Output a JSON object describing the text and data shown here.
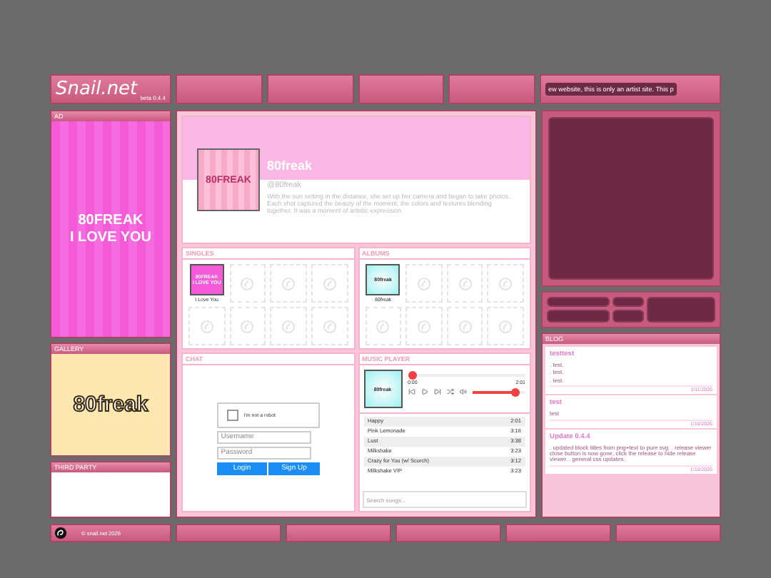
{
  "header": {
    "logo": "Snail.net",
    "version": "beta 0.4.4",
    "marquee": "ew website, this is only an artist site. This p"
  },
  "ad": {
    "title": "AD",
    "banner_lines": [
      "80FREAK",
      "I LOVE YOU"
    ]
  },
  "gallery": {
    "title": "GALLERY",
    "banner": "80freak"
  },
  "third_party": {
    "title": "THIRD PARTY"
  },
  "profile": {
    "cover": "80FREAK",
    "name": "80freak",
    "handle": "@80freak",
    "bio": "With the sun setting in the distance, she set up her camera and began to take photos. Each shot captured the beauty of the moment, the colors and textures blending together. It was a moment of artistic expression."
  },
  "singles": {
    "title": "SINGLES",
    "items": [
      {
        "cover_lines": [
          "80FREAK",
          "I LOVE YOU"
        ],
        "label": "I Love You"
      }
    ]
  },
  "albums": {
    "title": "ALBUMS",
    "items": [
      {
        "cover": "80freak",
        "label": "80freak"
      }
    ]
  },
  "chat": {
    "title": "CHAT",
    "captcha": "I'm not a robot",
    "captcha_checked": false,
    "username_placeholder": "Username",
    "password_placeholder": "Password",
    "buttons": [
      "Login",
      "Sign Up"
    ]
  },
  "player": {
    "title": "MUSIC PLAYER",
    "cover": "80freak",
    "elapsed": "0:00",
    "duration": "2:01",
    "progress": {
      "level": 0
    },
    "volume": {
      "level": 0.8
    },
    "search_placeholder": "Search songs...",
    "songs": [
      {
        "title": "Happy",
        "length": "2:01"
      },
      {
        "title": "Pink Lemonade",
        "length": "3:16"
      },
      {
        "title": "Lust",
        "length": "3:38"
      },
      {
        "title": "Milkshake",
        "length": "3:23"
      },
      {
        "title": "Crazy for You (w/ Scorch)",
        "length": "3:12"
      },
      {
        "title": "Milkshake VIP",
        "length": "3:23"
      }
    ]
  },
  "blog": {
    "title": "BLOG",
    "posts": [
      {
        "title": "testtest",
        "lines": [
          ". test.",
          ". test.",
          ". test."
        ],
        "date": "1/11/2026"
      },
      {
        "title": "test",
        "lines": [
          "test"
        ],
        "date": "1/10/2026"
      },
      {
        "title": "Update 0.4.4",
        "lines": [
          ". updated block titles from png+text to pure svg. . release viewer close button is now gone, click the release to hide release viewer. . general css updates."
        ],
        "date": "1/10/2026"
      }
    ]
  },
  "footer": {
    "text": "© snail.net 2026"
  }
}
